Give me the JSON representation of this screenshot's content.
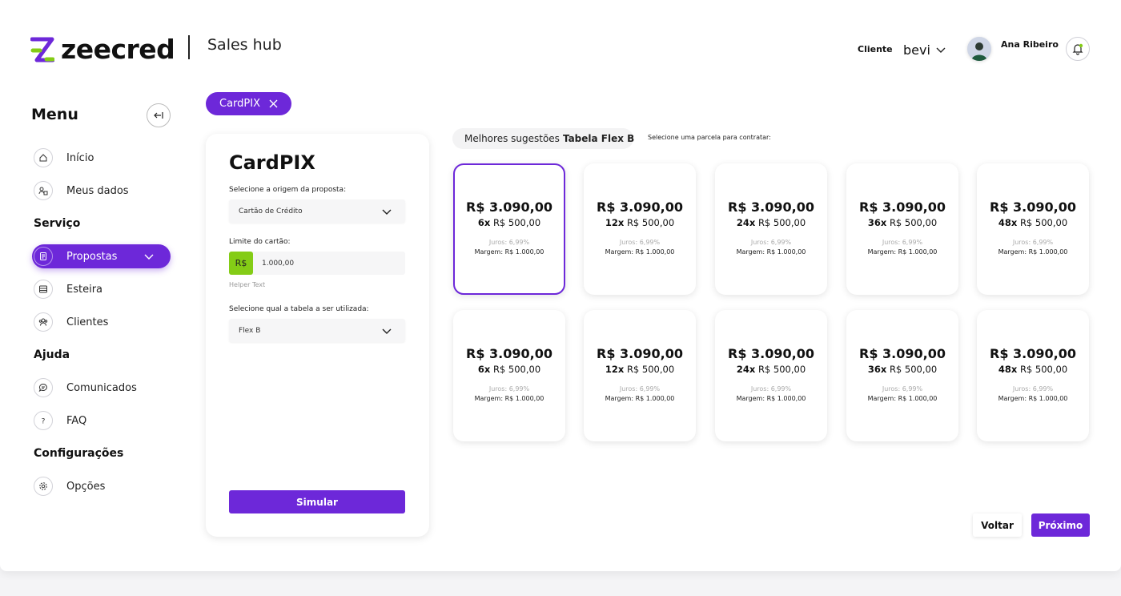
{
  "brand": {
    "name": "zeecred",
    "accent": "#6d28d9",
    "lime": "#84cc16"
  },
  "header": {
    "hub_title": "Sales hub",
    "client_label": "Cliente",
    "client_value": "bevi",
    "user_name": "Ana Ribeiro"
  },
  "sidebar": {
    "title": "Menu",
    "items": [
      {
        "label": "Início",
        "icon": "home-icon"
      },
      {
        "label": "Meus dados",
        "icon": "user-data-icon"
      },
      {
        "label": "Propostas",
        "icon": "document-icon",
        "active": true
      },
      {
        "label": "Esteira",
        "icon": "list-icon"
      },
      {
        "label": "Clientes",
        "icon": "people-icon"
      },
      {
        "label": "Comunicados",
        "icon": "chat-icon"
      },
      {
        "label": "FAQ",
        "icon": "question-icon"
      },
      {
        "label": "Opções",
        "icon": "gear-icon"
      }
    ],
    "sections": [
      "Serviço",
      "Ajuda",
      "Configurações"
    ]
  },
  "chip": {
    "label": "CardPIX"
  },
  "form": {
    "title": "CardPIX",
    "origin_label": "Selecione a origem da proposta:",
    "origin_value": "Cartão de Crédito",
    "limit_label": "Limite do cartão:",
    "currency_prefix": "R$",
    "limit_value": "1.000,00",
    "helper_text": "Helper Text",
    "table_label": "Selecione qual a tabela a ser utilizada:",
    "table_value": "Flex B",
    "simulate_label": "Simular"
  },
  "suggestions": {
    "prefix": "Melhores sugestões",
    "table_name": "Tabela Flex B",
    "hint": "Selecione uma parcela para contratar:",
    "cards": [
      {
        "amount": "R$ 3.090,00",
        "installments": "6x",
        "installment_value": "R$ 500,00",
        "juros": "Juros: 6,99%",
        "margem": "Margem: R$ 1.000,00",
        "selected": true
      },
      {
        "amount": "R$ 3.090,00",
        "installments": "12x",
        "installment_value": "R$ 500,00",
        "juros": "Juros: 6,99%",
        "margem": "Margem: R$ 1.000,00"
      },
      {
        "amount": "R$ 3.090,00",
        "installments": "24x",
        "installment_value": "R$ 500,00",
        "juros": "Juros: 6,99%",
        "margem": "Margem: R$ 1.000,00"
      },
      {
        "amount": "R$ 3.090,00",
        "installments": "36x",
        "installment_value": "R$ 500,00",
        "juros": "Juros: 6,99%",
        "margem": "Margem: R$ 1.000,00"
      },
      {
        "amount": "R$ 3.090,00",
        "installments": "48x",
        "installment_value": "R$ 500,00",
        "juros": "Juros: 6,99%",
        "margem": "Margem: R$ 1.000,00"
      },
      {
        "amount": "R$ 3.090,00",
        "installments": "6x",
        "installment_value": "R$ 500,00",
        "juros": "Juros: 6,99%",
        "margem": "Margem: R$ 1.000,00"
      },
      {
        "amount": "R$ 3.090,00",
        "installments": "12x",
        "installment_value": "R$ 500,00",
        "juros": "Juros: 6,99%",
        "margem": "Margem: R$ 1.000,00"
      },
      {
        "amount": "R$ 3.090,00",
        "installments": "24x",
        "installment_value": "R$ 500,00",
        "juros": "Juros: 6,99%",
        "margem": "Margem: R$ 1.000,00"
      },
      {
        "amount": "R$ 3.090,00",
        "installments": "36x",
        "installment_value": "R$ 500,00",
        "juros": "Juros: 6,99%",
        "margem": "Margem: R$ 1.000,00"
      },
      {
        "amount": "R$ 3.090,00",
        "installments": "48x",
        "installment_value": "R$ 500,00",
        "juros": "Juros: 6,99%",
        "margem": "Margem: R$ 1.000,00"
      }
    ]
  },
  "footer": {
    "back_label": "Voltar",
    "next_label": "Próximo"
  }
}
